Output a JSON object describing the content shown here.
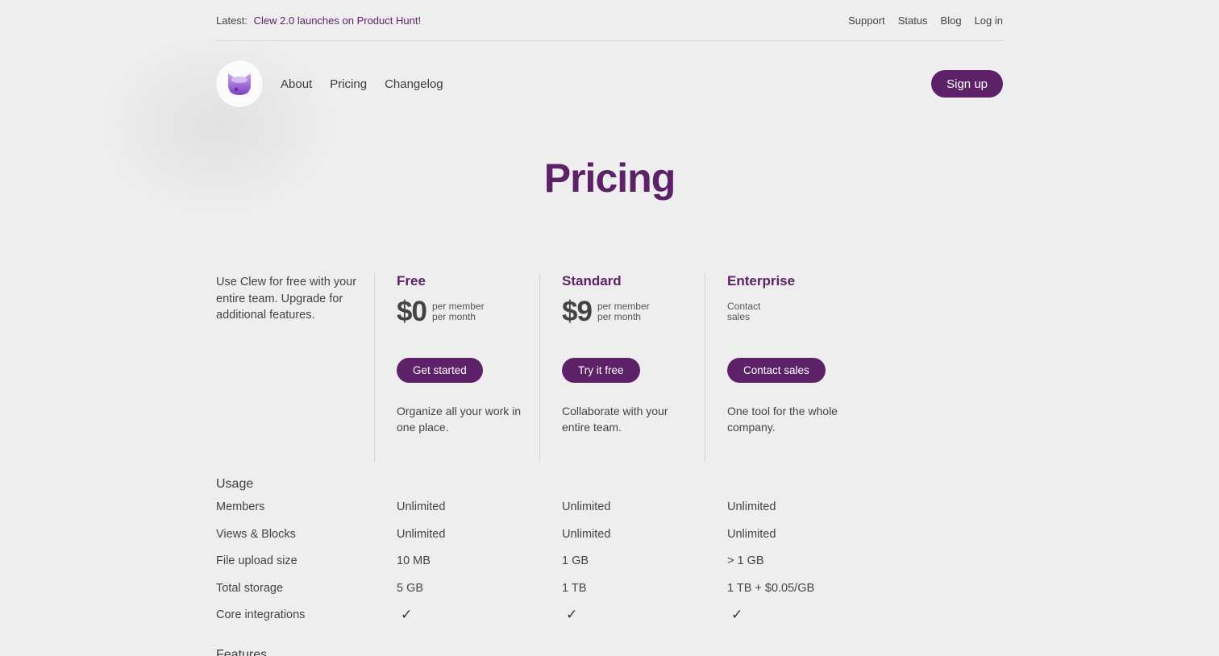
{
  "topbar": {
    "latest_label": "Latest:",
    "announcement": "Clew 2.0 launches on Product Hunt!",
    "links": [
      "Support",
      "Status",
      "Blog",
      "Log in"
    ]
  },
  "nav": {
    "links": [
      "About",
      "Pricing",
      "Changelog"
    ],
    "signup": "Sign up"
  },
  "page": {
    "title": "Pricing"
  },
  "intro": "Use Clew for free with your entire team. Upgrade for additional features.",
  "plans": [
    {
      "name": "Free",
      "price": "$0",
      "per_line1": "per member",
      "per_line2": "per month",
      "cta": "Get started",
      "desc": "Organize all your work in one place."
    },
    {
      "name": "Standard",
      "price": "$9",
      "per_line1": "per member",
      "per_line2": "per month",
      "cta": "Try it free",
      "desc": "Collaborate with your entire team."
    },
    {
      "name": "Enterprise",
      "price_note": "Contact sales",
      "cta": "Contact sales",
      "desc": "One tool for the whole company."
    }
  ],
  "usage": {
    "title": "Usage",
    "rows": [
      {
        "label": "Members",
        "values": [
          "Unlimited",
          "Unlimited",
          "Unlimited"
        ]
      },
      {
        "label": "Views & Blocks",
        "values": [
          "Unlimited",
          "Unlimited",
          "Unlimited"
        ]
      },
      {
        "label": "File upload size",
        "values": [
          "10 MB",
          "1 GB",
          "> 1 GB"
        ]
      },
      {
        "label": "Total storage",
        "values": [
          "5 GB",
          "1 TB",
          "1 TB + $0.05/GB"
        ]
      },
      {
        "label": "Core integrations",
        "values": [
          "✓",
          "✓",
          "✓"
        ]
      }
    ]
  },
  "features": {
    "title": "Features"
  },
  "colors": {
    "brand": "#5c2166",
    "background": "#edeeed",
    "divider": "#d6d7d6"
  },
  "icons": {
    "logo": "cat-logo-icon",
    "check": "check-icon"
  }
}
